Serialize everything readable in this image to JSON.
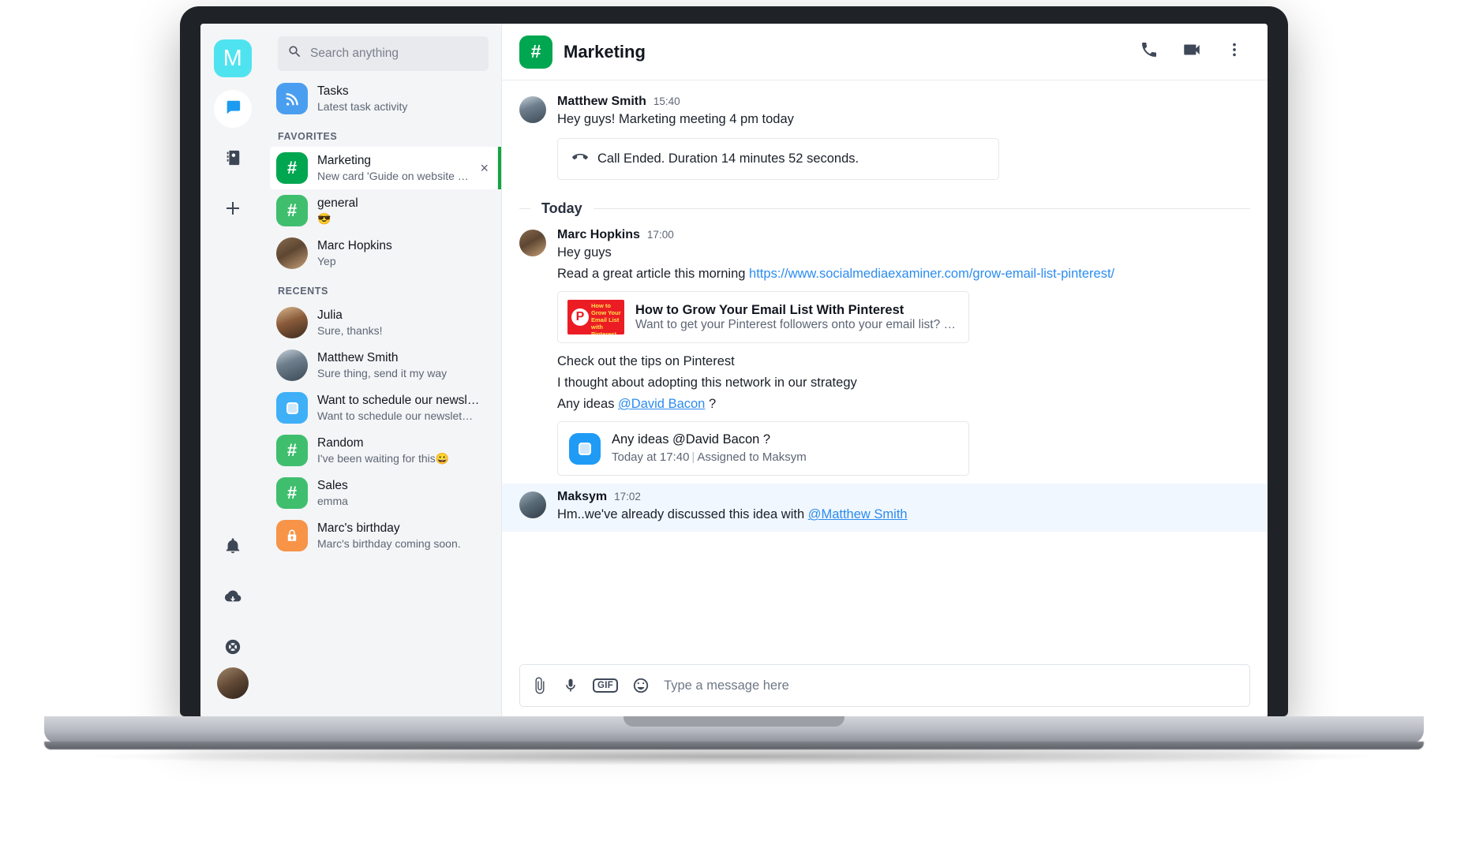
{
  "app": {
    "logo_letter": "M",
    "logo_color": "#4fe3ef"
  },
  "rail": {
    "items": [
      {
        "name": "chat",
        "icon": "chat-bubble-icon",
        "active": true
      },
      {
        "name": "contacts",
        "icon": "contacts-book-icon",
        "active": false
      },
      {
        "name": "add",
        "icon": "plus-icon",
        "active": false
      },
      {
        "name": "notifications",
        "icon": "bell-icon",
        "active": false
      },
      {
        "name": "downloads",
        "icon": "cloud-download-icon",
        "active": false
      },
      {
        "name": "support",
        "icon": "lifebuoy-icon",
        "active": false
      }
    ]
  },
  "search": {
    "placeholder": "Search anything",
    "value": "",
    "icon": "search-icon"
  },
  "sidebar": {
    "tasks": {
      "title": "Tasks",
      "subtitle": "Latest task activity",
      "icon": "rss-feed-icon",
      "color": "#4a9ef0"
    },
    "favorites_label": "FAVORITES",
    "recents_label": "RECENTS",
    "favorites": [
      {
        "title": "Marketing",
        "subtitle": "New card 'Guide on website o…",
        "icon": "hash-icon",
        "color": "#00a650",
        "selected": true,
        "close_label": "×"
      },
      {
        "title": "general",
        "subtitle": "😎",
        "icon": "hash-icon",
        "color": "#3fbf6e",
        "selected": false
      },
      {
        "title": "Marc Hopkins",
        "subtitle": "Yep",
        "icon": "avatar",
        "avatar_class": "ph-marc",
        "selected": false
      }
    ],
    "recents": [
      {
        "title": "Julia",
        "subtitle": "Sure, thanks!",
        "icon": "avatar",
        "avatar_class": "ph-julia"
      },
      {
        "title": "Matthew Smith",
        "subtitle": "Sure thing, send it my way",
        "icon": "avatar",
        "avatar_class": "ph-matthew"
      },
      {
        "title": "Want to schedule our newsl…",
        "subtitle": "Want to schedule our newslet…",
        "icon": "task-square-icon",
        "color": "#3fb0f7"
      },
      {
        "title": "Random",
        "subtitle": "I've been waiting for this😀",
        "icon": "hash-icon",
        "color": "#3fbf6e"
      },
      {
        "title": "Sales",
        "subtitle": "emma",
        "icon": "hash-icon",
        "color": "#3fbf6e"
      },
      {
        "title": "Marc's birthday",
        "subtitle": "Marc's birthday coming soon.",
        "icon": "lock-icon",
        "color": "#f79448"
      }
    ]
  },
  "chat": {
    "header": {
      "icon": "hash-icon",
      "icon_color": "#00a650",
      "title": "Marketing",
      "actions": [
        {
          "name": "call",
          "icon": "phone-icon"
        },
        {
          "name": "video-call",
          "icon": "video-camera-icon"
        },
        {
          "name": "more",
          "icon": "more-vertical-icon"
        }
      ]
    },
    "day_divider": "Today",
    "messages": [
      {
        "author": "Matthew Smith",
        "time": "15:40",
        "avatar_class": "ph-matthew",
        "lines": [
          "Hey guys! Marketing meeting 4 pm today"
        ],
        "call_card": {
          "icon": "phone-hangup-icon",
          "text": "Call Ended. Duration 14 minutes 52 seconds."
        }
      },
      {
        "author": "Marc Hopkins",
        "time": "17:00",
        "avatar_class": "ph-marc",
        "line1": "Hey guys",
        "line2_prefix": "Read a great article this morning ",
        "link_text": "https://www.socialmediaexaminer.com/grow-email-list-pinterest/",
        "link_card": {
          "title": "How to Grow Your Email List With Pinterest",
          "description": "Want to get your Pinterest followers onto your email list? Di…",
          "thumb_text": "How to Grow Your Email List with Pinterest"
        },
        "line3": "Check out the tips on Pinterest",
        "line4": "I thought about adopting this network in our strategy",
        "line5_prefix": "Any ideas ",
        "mention": "@David Bacon",
        "line5_suffix": " ?",
        "task_card": {
          "title": "Any ideas @David Bacon ?",
          "date": "Today at 17:40",
          "separator": "|",
          "assigned_prefix": "Assigned to",
          "assignee": "Maksym",
          "icon": "task-square-icon"
        }
      },
      {
        "author": "Maksym",
        "time": "17:02",
        "avatar_class": "ph-maksym",
        "highlight": true,
        "text_prefix": "Hm..we've already discussed this idea with ",
        "mention": "@Matthew Smith"
      }
    ]
  },
  "composer": {
    "placeholder": "Type a message here",
    "value": "",
    "icons": [
      {
        "name": "attachment",
        "label": "paperclip-icon"
      },
      {
        "name": "voice",
        "label": "microphone-icon"
      },
      {
        "name": "gif",
        "label": "GIF"
      },
      {
        "name": "emoji",
        "label": "smiley-icon"
      }
    ],
    "gif_label": "GIF"
  }
}
